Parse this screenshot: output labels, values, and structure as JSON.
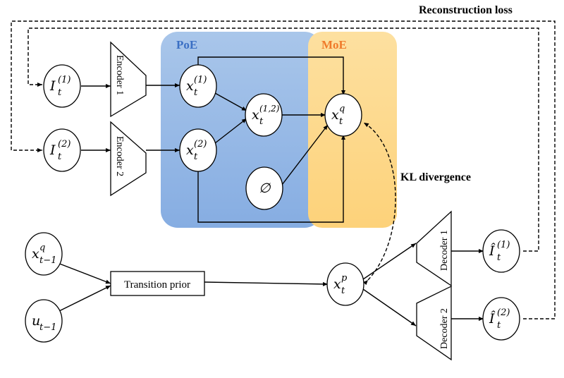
{
  "labels": {
    "reconstruction_loss": "Reconstruction loss",
    "kl_divergence": "KL divergence",
    "poe": "PoE",
    "moe": "MoE",
    "encoder_1": "Encoder 1",
    "encoder_2": "Encoder 2",
    "decoder_1": "Decoder 1",
    "decoder_2": "Decoder 2",
    "transition_prior": "Transition prior"
  },
  "colors": {
    "poe_region": "#7fa8dc",
    "moe_region": "#fdd27a",
    "poe_label": "#3a6fc4",
    "moe_label": "#f07a2a"
  },
  "nodes": {
    "I1": {
      "base": "I",
      "sub": "t",
      "sup": "(1)"
    },
    "I2": {
      "base": "I",
      "sub": "t",
      "sup": "(2)"
    },
    "x1": {
      "base": "x",
      "sub": "t",
      "sup": "(1)"
    },
    "x2": {
      "base": "x",
      "sub": "t",
      "sup": "(2)"
    },
    "x12": {
      "base": "x",
      "sub": "t",
      "sup": "(1,2)"
    },
    "xq": {
      "base": "x",
      "sub": "t",
      "sup": "q"
    },
    "empty": {
      "base": "∅"
    },
    "xq_prev": {
      "base": "x",
      "sub": "t−1",
      "sup": "q"
    },
    "u_prev": {
      "base": "u",
      "sub": "t−1"
    },
    "xp": {
      "base": "x",
      "sub": "t",
      "sup": "p"
    },
    "Ihat1": {
      "base": "Î",
      "sub": "t",
      "sup": "(1)"
    },
    "Ihat2": {
      "base": "Î",
      "sub": "t",
      "sup": "(2)"
    }
  }
}
